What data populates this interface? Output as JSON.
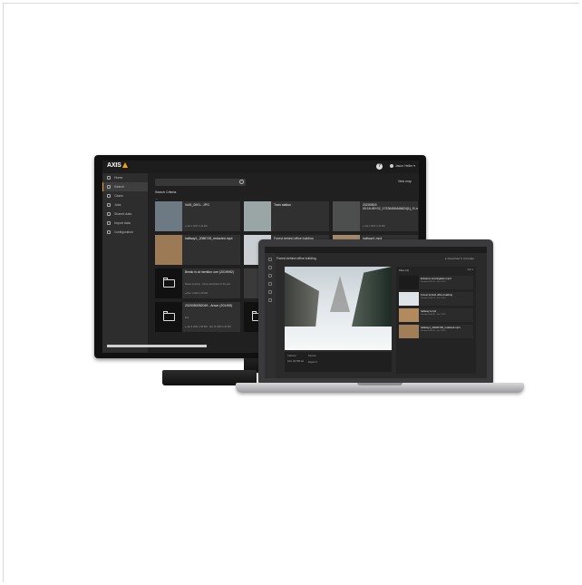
{
  "monitor": {
    "brand": "AXIS",
    "help_label": "?",
    "user_label": "Jason Heller ▾",
    "sidebar": [
      {
        "label": "Home",
        "active": false
      },
      {
        "label": "Search",
        "active": true
      },
      {
        "label": "Cases",
        "active": false
      },
      {
        "label": "Jobs",
        "active": false
      },
      {
        "label": "Shared data",
        "active": false
      },
      {
        "label": "Import data",
        "active": false
      },
      {
        "label": "Configuration",
        "active": false
      }
    ],
    "view_map": "View map",
    "breadcrumb": "Search Criteria",
    "back_arrow": "←",
    "cards": [
      {
        "title": "VoIS_0001...JPG",
        "meta2": "",
        "meta": "● Jan 1 2017 1:10 AM",
        "thumb": "#6d7a84",
        "folder": false
      },
      {
        "title": "Train station",
        "meta2": "",
        "meta": "",
        "thumb": "#9aa5a6",
        "folder": false
      },
      {
        "title": "20200503 00:16:45+02_17226406446624(1)_f1.mp4",
        "meta2": "",
        "meta": "● Jan 1 2017 1:10 PM",
        "thumb": "#4d4f4f",
        "folder": false
      },
      {
        "title": "hallway1_2086728_redacted.mp4",
        "meta2": "",
        "meta": "",
        "thumb": "#9b7a55",
        "folder": false
      },
      {
        "title": "Forest behind office building",
        "meta2": "",
        "meta": "",
        "thumb": "#c9cfd3",
        "folder": false
      },
      {
        "title": "hallway1.mp4",
        "meta2": "",
        "meta": "",
        "thumb": "#a48a6c",
        "folder": false
      },
      {
        "title": "Break in at mention one (2019992)",
        "meta2": "Stolen property · Some description in the text",
        "meta": "● Dec 1 2021 1:18 AM",
        "thumb": "#111",
        "folder": true
      },
      {
        "title": "",
        "meta2": "",
        "meta": "",
        "thumb": "#3a3a3a",
        "folder": false
      },
      {
        "title": "",
        "meta2": "",
        "meta": "",
        "thumb": "#3a3a3a",
        "folder": false
      },
      {
        "title": "2020050052049 - Arson (201495)",
        "meta2": "Fire",
        "meta": "● Jan 2 2021 1:58 PM · Jan 13 2023 1:42 PM",
        "thumb": "#111",
        "folder": true
      },
      {
        "title": "",
        "meta2": "",
        "meta": "",
        "thumb": "#111",
        "folder": true
      },
      {
        "title": "",
        "meta2": "",
        "meta": "",
        "thumb": "#3a3a3a",
        "folder": false
      }
    ]
  },
  "laptop": {
    "header_title": "Forest behind office building",
    "actions": "▸ Download   ✎ Annotate",
    "panel_title": "Files (4)",
    "panel_button": "Sort ▾",
    "panel_items": [
      {
        "name": "Entrance investigation.mp4",
        "meta": "Duration 00:14:20 · Jan 5 2021",
        "thumb": "#1b1b1b"
      },
      {
        "name": "Forest behind office building",
        "meta": "Duration 00:01:20 · Jan 1 2021",
        "thumb": "#dfe4e8"
      },
      {
        "name": "hallway1.mp4",
        "meta": "Duration 00:00:45 · Jan 1 2021",
        "thumb": "#b18a5d"
      },
      {
        "name": "hallway1_20200728_redacted.mp4",
        "meta": "Duration 00:00:45 · Jan 1 2021",
        "thumb": "#a07e57"
      }
    ],
    "controls": {
      "label_a": "Camera",
      "label_b": "Source",
      "value_a": "Axis Q1798-LE",
      "value_b": "Export ▾"
    }
  }
}
